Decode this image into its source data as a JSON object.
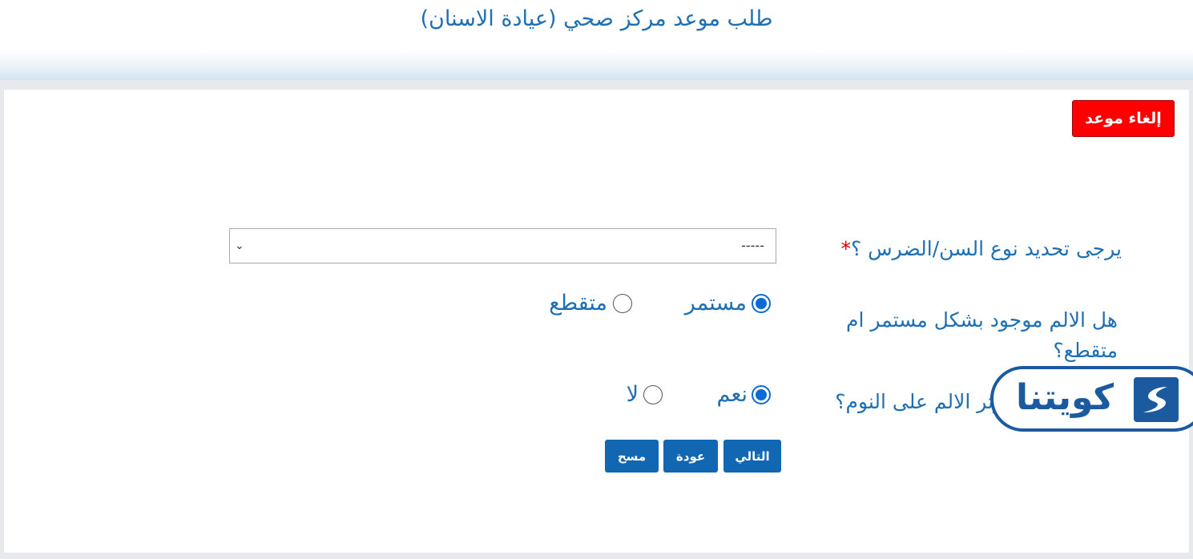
{
  "header": {
    "title": "طلب موعد مركز صحي (عيادة الاسنان)"
  },
  "actions": {
    "cancel_label": "إلغاء موعد"
  },
  "form": {
    "tooth_type": {
      "label": "يرجى تحديد نوع السن/الضرس ؟",
      "required_mark": "*",
      "selected_value": "-----"
    },
    "pain_continuity": {
      "label": "هل الالم موجود بشكل مستمر ام متقطع؟",
      "options": [
        "مستمر",
        "متقطع"
      ],
      "selected": "مستمر"
    },
    "pain_sleep": {
      "label": "هل يؤثر الالم على النوم؟",
      "options": [
        "نعم",
        "لا"
      ],
      "selected": "نعم"
    }
  },
  "buttons": {
    "next_label": "التالي",
    "back_label": "عودة",
    "clear_label": "مسح"
  },
  "logo": {
    "text": "كويتنا"
  },
  "colors": {
    "accent": "#1f6fb3",
    "button": "#1167b1",
    "danger": "#ff0000",
    "radio": "#0a6bd6"
  }
}
